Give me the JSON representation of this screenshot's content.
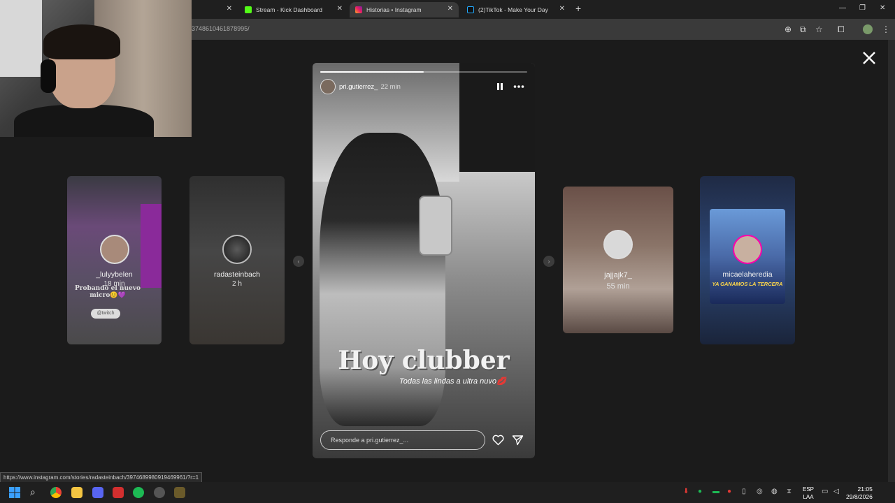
{
  "browser": {
    "tabs": [
      {
        "title": "",
        "favicon": "blank",
        "active": false
      },
      {
        "title": "Stream - Kick Dashboard",
        "favicon": "kick-icon",
        "active": false
      },
      {
        "title": "Historias • Instagram",
        "favicon": "instagram-icon",
        "active": true
      },
      {
        "title": "(2)TikTok - Make Your Day",
        "favicon": "tiktok-icon",
        "active": false
      }
    ],
    "new_tab": "+",
    "url": "3748610461878995/",
    "window_controls": {
      "minimize": "—",
      "restore": "❐",
      "close": "✕"
    }
  },
  "stories": {
    "close_label": "✕",
    "left_cards": [
      {
        "username": "_lulyybelen",
        "time": "18 min",
        "overlay_text": "Probando el nuevo micro😊💜",
        "tag": "@twitch"
      },
      {
        "username": "radasteinbach",
        "time": "2 h"
      }
    ],
    "right_cards": [
      {
        "username": "jajjajk7_",
        "time": "55 min"
      },
      {
        "username": "micaelaheredia",
        "time": "",
        "banner_text": "YA GANAMOS LA TERCERA"
      }
    ],
    "main": {
      "username": "pri.gutierrez_",
      "time": "22 min",
      "progress": 0.5,
      "title": "Hoy clubber",
      "subtitle": "Todas las lindas a ultra nuvo💋",
      "reply_placeholder": "Responde a pri.gutierrez_..."
    }
  },
  "status_url": "https://www.instagram.com/stories/radasteinbach/3974689980919469961/?r=1",
  "taskbar": {
    "language": "ESP",
    "layout": "LAA",
    "time": "21:05",
    "date": "29/8/2026"
  }
}
